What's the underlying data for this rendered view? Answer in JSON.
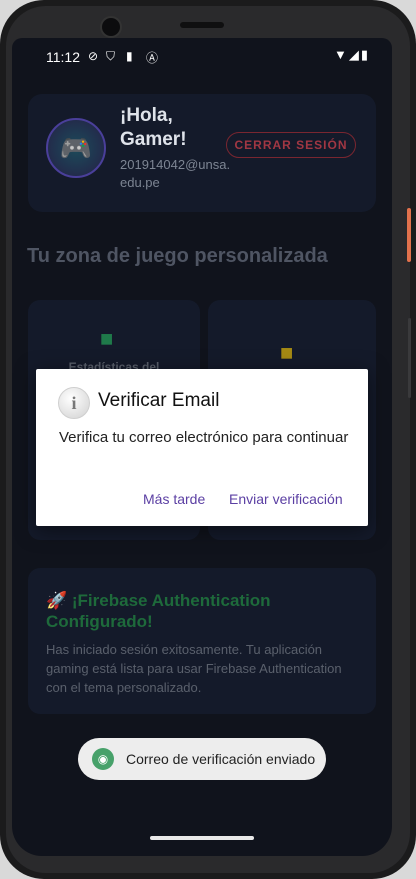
{
  "status_bar": {
    "time": "11:12",
    "icons": [
      "do-not-disturb-icon",
      "shield-icon",
      "sd-card-icon",
      "a-icon"
    ],
    "right_icons": [
      "wifi-icon",
      "cell-signal-icon",
      "battery-icon"
    ]
  },
  "header": {
    "greeting": "¡Hola, Gamer!",
    "email": "201914042@unsa.edu.pe",
    "logout_label": "CERRAR SESIÓN"
  },
  "section_title": "Tu zona de juego personalizada",
  "cards": [
    {
      "label": "Estadísticas del",
      "icon": "gamepad-icon",
      "color": "#1f7a4a"
    },
    {
      "label": "",
      "icon": "gamepad-icon",
      "color": "#a58a14"
    }
  ],
  "firebase_card": {
    "title": "🚀 ¡Firebase Authentication Configurado!",
    "text": "Has iniciado sesión exitosamente. Tu aplicación gaming está lista para usar Firebase Authentication con el tema personalizado."
  },
  "dialog": {
    "title": "Verificar Email",
    "message": "Verifica tu correo electrónico para continuar",
    "later_label": "Más tarde",
    "send_label": "Enviar verificación"
  },
  "toast": {
    "text": "Correo de verificación enviado"
  }
}
